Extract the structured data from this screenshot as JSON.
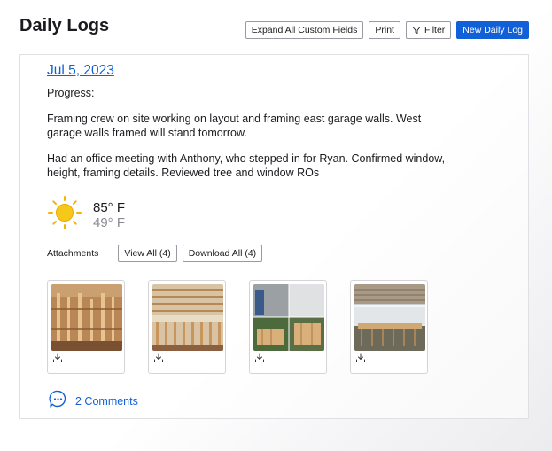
{
  "header": {
    "title": "Daily Logs",
    "expand_label": "Expand All Custom Fields",
    "print_label": "Print",
    "filter_label": "Filter",
    "new_label": "New Daily Log"
  },
  "log": {
    "date": "Jul 5, 2023",
    "progress_label": "Progress:",
    "paragraph1": "Framing crew on site working on layout and framing east garage walls. West garage walls framed will stand tomorrow.",
    "paragraph2": "Had an office meeting with Anthony, who stepped in for Ryan. Confirmed window, height, framing details. Reviewed tree and window ROs",
    "weather": {
      "icon": "sun-icon",
      "high": "85° F",
      "low": "49° F"
    },
    "attachments": {
      "label": "Attachments",
      "view_all": "View All (4)",
      "download_all": "Download All (4)",
      "items": [
        {
          "icon": "download-icon"
        },
        {
          "icon": "download-icon"
        },
        {
          "icon": "download-icon"
        },
        {
          "icon": "download-icon"
        }
      ]
    },
    "comments": {
      "icon": "comment-bubble-icon",
      "label": "2 Comments"
    }
  },
  "colors": {
    "accent": "#1160d8",
    "sun": "#f5b800",
    "muted": "#8a8a92"
  }
}
